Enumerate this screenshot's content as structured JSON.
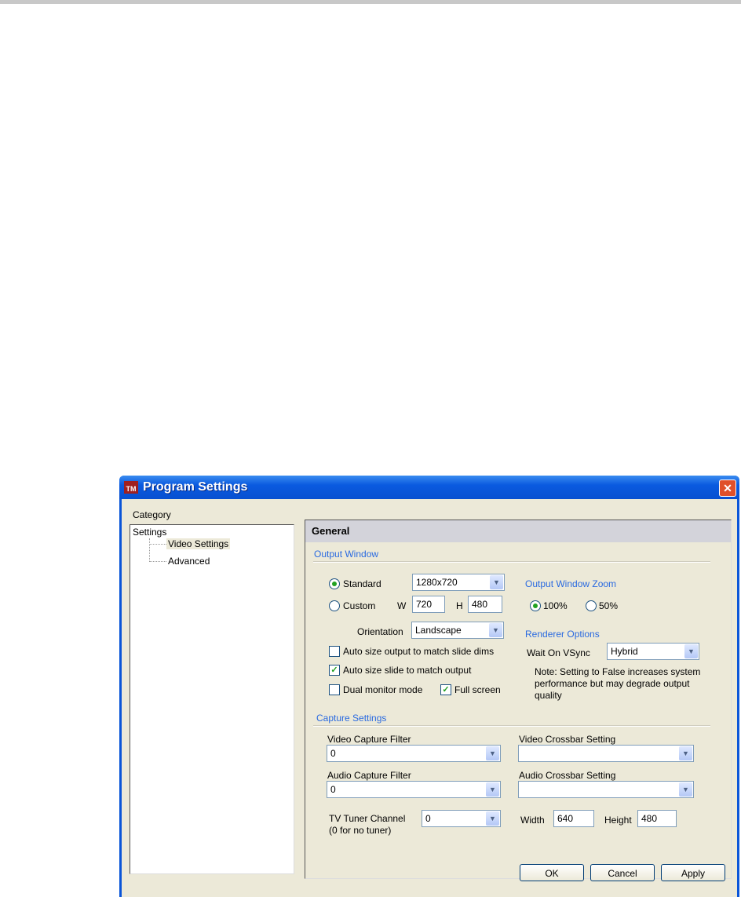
{
  "window": {
    "title": "Program Settings"
  },
  "category_label": "Category",
  "tree": {
    "root": "Settings",
    "items": [
      "Video Settings",
      "Advanced"
    ]
  },
  "panel": {
    "header": "General",
    "output_window": {
      "title": "Output Window",
      "standard_label": "Standard",
      "standard_value": "1280x720",
      "custom_label": "Custom",
      "w_label": "W",
      "w_value": "720",
      "h_label": "H",
      "h_value": "480",
      "orientation_label": "Orientation",
      "orientation_value": "Landscape",
      "auto_size_output": "Auto size output to match slide dims",
      "auto_size_slide": "Auto size slide to match output",
      "dual_monitor": "Dual monitor mode",
      "full_screen": "Full screen"
    },
    "zoom": {
      "title": "Output Window Zoom",
      "opt100": "100%",
      "opt50": "50%"
    },
    "renderer": {
      "title": "Renderer Options",
      "vsync_label": "Wait On VSync",
      "vsync_value": "Hybrid",
      "note": "Note: Setting to False increases system performance but may degrade output quality"
    },
    "capture": {
      "title": "Capture Settings",
      "video_filter_label": "Video Capture Filter",
      "video_filter_value": "0",
      "video_crossbar_label": "Video Crossbar Setting",
      "video_crossbar_value": "",
      "audio_filter_label": "Audio Capture Filter",
      "audio_filter_value": "0",
      "audio_crossbar_label": "Audio Crossbar Setting",
      "audio_crossbar_value": "",
      "tuner_label": "TV Tuner Channel",
      "tuner_sub": "(0 for no tuner)",
      "tuner_value": "0",
      "width_label": "Width",
      "width_value": "640",
      "height_label": "Height",
      "height_value": "480"
    }
  },
  "buttons": {
    "ok": "OK",
    "cancel": "Cancel",
    "apply": "Apply"
  }
}
